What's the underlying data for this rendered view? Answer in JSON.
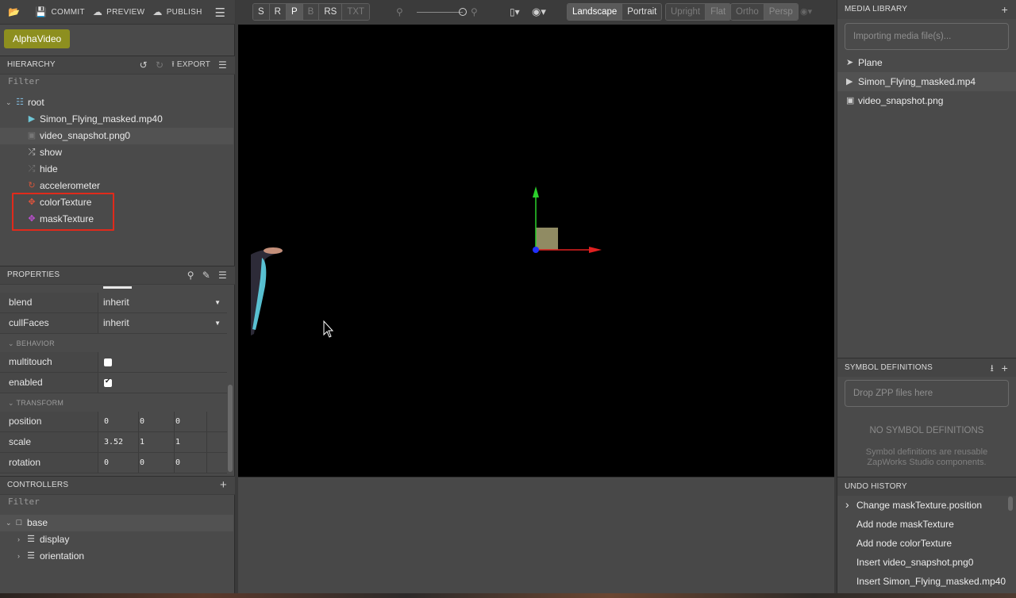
{
  "topbar": {
    "commit_label": "COMMIT",
    "preview_label": "PREVIEW",
    "publish_label": "PUBLISH"
  },
  "project": {
    "name": "AlphaVideo"
  },
  "hierarchy": {
    "title": "HIERARCHY",
    "export_label": "EXPORT",
    "filter_placeholder": "Filter",
    "nodes": [
      {
        "label": "root",
        "icon": "hierarchy-icon"
      },
      {
        "label": "Simon_Flying_masked.mp40",
        "icon": "video-icon"
      },
      {
        "label": "video_snapshot.png0",
        "icon": "image-icon"
      },
      {
        "label": "show",
        "icon": "shuffle-icon"
      },
      {
        "label": "hide",
        "icon": "shuffle-icon"
      },
      {
        "label": "accelerometer",
        "icon": "refresh-icon"
      },
      {
        "label": "colorTexture",
        "icon": "move-icon",
        "color": "#e0533c"
      },
      {
        "label": "maskTexture",
        "icon": "move-icon",
        "color": "#c04fd6"
      }
    ]
  },
  "properties": {
    "title": "PROPERTIES",
    "blend": {
      "key": "blend",
      "value": "inherit"
    },
    "cullFaces": {
      "key": "cullFaces",
      "value": "inherit"
    },
    "behavior_label": "BEHAVIOR",
    "multitouch": {
      "key": "multitouch",
      "checked": false
    },
    "enabled": {
      "key": "enabled",
      "checked": true
    },
    "transform_label": "TRANSFORM",
    "position": {
      "key": "position",
      "x": "0",
      "y": "0",
      "z": "0"
    },
    "scale": {
      "key": "scale",
      "x": "3.52",
      "y": "1",
      "z": "1"
    },
    "rotation": {
      "key": "rotation",
      "x": "0",
      "y": "0",
      "z": "0"
    }
  },
  "controllers": {
    "title": "CONTROLLERS",
    "filter_placeholder": "Filter",
    "items": [
      {
        "label": "base"
      },
      {
        "label": "display"
      },
      {
        "label": "orientation"
      }
    ]
  },
  "viewport_toolbar": {
    "transform_modes": [
      "S",
      "R",
      "P",
      "B",
      "RS",
      "TXT"
    ],
    "orientation": [
      "Landscape",
      "Portrait"
    ],
    "view_mode": [
      "Upright",
      "Flat"
    ],
    "projection": [
      "Ortho",
      "Persp"
    ]
  },
  "media_library": {
    "title": "MEDIA LIBRARY",
    "import_placeholder": "Importing media file(s)...",
    "items": [
      {
        "label": "Plane",
        "icon": "rocket-icon"
      },
      {
        "label": "Simon_Flying_masked.mp4",
        "icon": "video-icon"
      },
      {
        "label": "video_snapshot.png",
        "icon": "image-icon"
      }
    ]
  },
  "symbol_definitions": {
    "title": "SYMBOL DEFINITIONS",
    "drop_placeholder": "Drop ZPP files here",
    "empty_title": "NO SYMBOL DEFINITIONS",
    "empty_desc_1": "Symbol definitions are reusable",
    "empty_desc_2": "ZapWorks Studio components."
  },
  "undo_history": {
    "title": "UNDO HISTORY",
    "items": [
      "Change maskTexture.position",
      "Add node maskTexture",
      "Add node colorTexture",
      "Insert video_snapshot.png0",
      "Insert Simon_Flying_masked.mp40"
    ]
  }
}
